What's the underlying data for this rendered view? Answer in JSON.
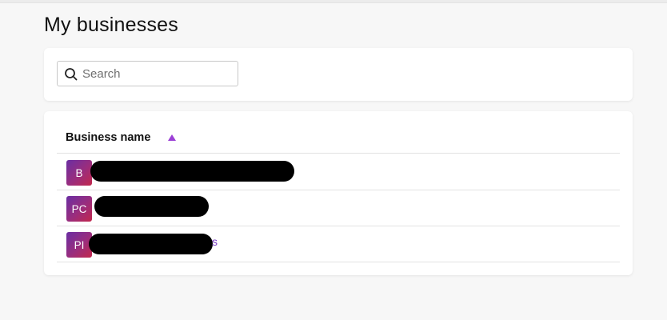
{
  "page": {
    "title": "My businesses"
  },
  "search": {
    "placeholder": "Search",
    "value": ""
  },
  "table": {
    "columns": [
      {
        "label": "Business name",
        "sort": "ascending"
      }
    ],
    "rows": [
      {
        "initials": "B",
        "name": "",
        "name_tail": ""
      },
      {
        "initials": "PC",
        "name": "",
        "name_tail": ""
      },
      {
        "initials": "PI",
        "name": "",
        "name_tail": "s"
      }
    ]
  },
  "colors": {
    "accent": "#7b3fc4",
    "sort_arrow": "#9b3fd6",
    "avatar_gradient": [
      "#6a2fa3",
      "#c2284c"
    ],
    "background": "#f7f7f7"
  },
  "icons": {
    "search": "search-icon",
    "sort": "sort-ascending-icon"
  }
}
